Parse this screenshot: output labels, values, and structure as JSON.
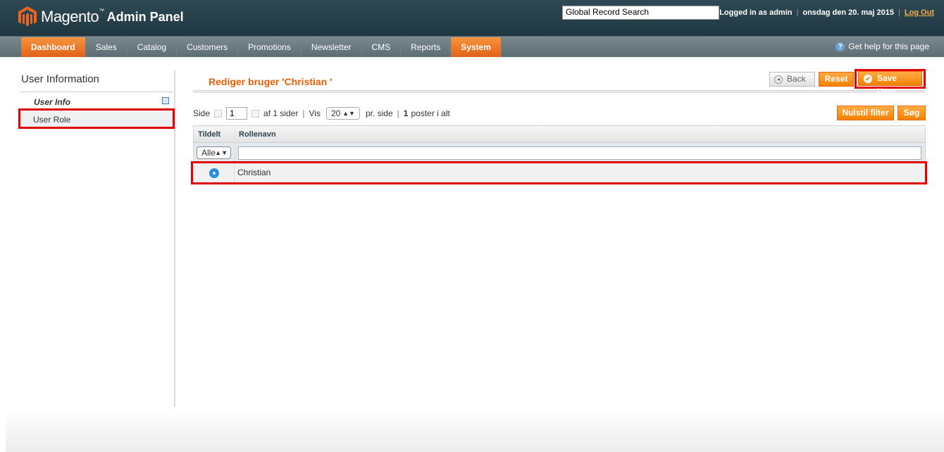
{
  "header": {
    "logo_text": "Magento",
    "logo_tm": "™",
    "logo_sub": "Admin Panel",
    "search_value": "Global Record Search",
    "logged_in": "Logged in as admin",
    "date": "onsdag den 20. maj 2015",
    "logout": "Log Out"
  },
  "nav": {
    "items": [
      "Dashboard",
      "Sales",
      "Catalog",
      "Customers",
      "Promotions",
      "Newsletter",
      "CMS",
      "Reports",
      "System"
    ],
    "help": "Get help for this page"
  },
  "sidebar": {
    "title": "User Information",
    "tabs": [
      "User Info",
      "User Role"
    ]
  },
  "content": {
    "title": "Rediger bruger 'Christian '",
    "buttons": {
      "back": "Back",
      "reset": "Reset",
      "save": "Save User",
      "reset_filter": "Nulstil filter",
      "search": "Søg"
    }
  },
  "pager": {
    "side_label": "Side",
    "page": "1",
    "of_pages": "af 1 sider",
    "show_label": "Vis",
    "per_page": "20",
    "per_page_suffix": "pr. side",
    "total_count": "1",
    "total_suffix": "poster i alt"
  },
  "grid": {
    "headers": [
      "Tildelt",
      "Rollenavn"
    ],
    "filter_select": "Alle",
    "rows": [
      {
        "role": "Christian",
        "assigned": true
      }
    ]
  },
  "colors": {
    "accent": "#eb5e00",
    "highlight": "#e00000",
    "header_bg": "#2f4a55"
  }
}
